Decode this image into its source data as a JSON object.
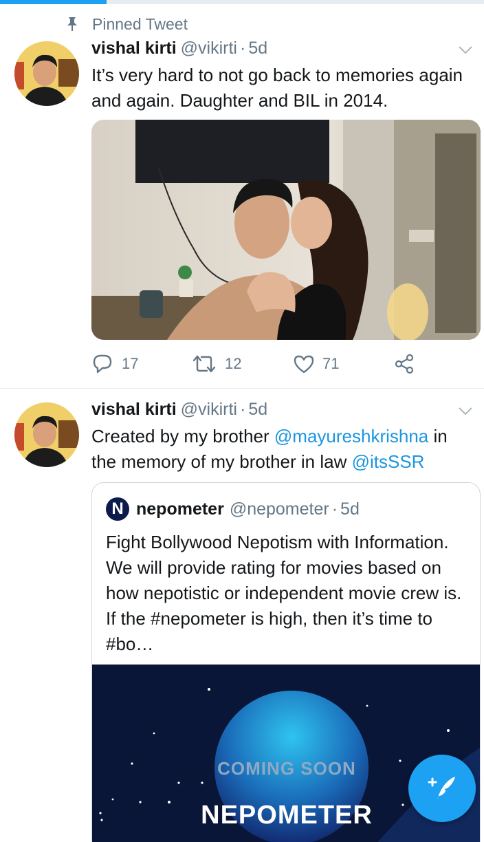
{
  "progress": {
    "fraction": 0.22,
    "color": "#1da1f2"
  },
  "tweets": [
    {
      "pinned_label": "Pinned Tweet",
      "display_name": "vishal kirti",
      "handle": "@vikirti",
      "separator": "·",
      "timestamp": "5d",
      "text": "It’s very hard to not go back to memories again and again. Daughter and BIL in 2014.",
      "actions": {
        "replies": "17",
        "retweets": "12",
        "likes": "71"
      }
    },
    {
      "display_name": "vishal kirti",
      "handle": "@vikirti",
      "separator": "·",
      "timestamp": "5d",
      "text_before": "Created by my brother ",
      "mention_1": "@mayureshkrishna",
      "text_middle": " in the memory of my brother in law ",
      "mention_2": "@itsSSR",
      "quote": {
        "avatar_letter": "N",
        "display_name": "nepometer",
        "handle": "@nepometer",
        "separator": "·",
        "timestamp": "5d",
        "text": "Fight Bollywood Nepotism with Information. We will provide rating for movies based on how nepotistic or independent movie crew is. If the #nepometer is high, then it’s time to #bo…",
        "media": {
          "subtitle": "COMING SOON",
          "title": "NEPOMETER"
        }
      }
    }
  ],
  "fab": {
    "icon": "compose-tweet-icon"
  },
  "colors": {
    "accent": "#1da1f2",
    "muted": "#657786",
    "link": "#1b95e0"
  }
}
